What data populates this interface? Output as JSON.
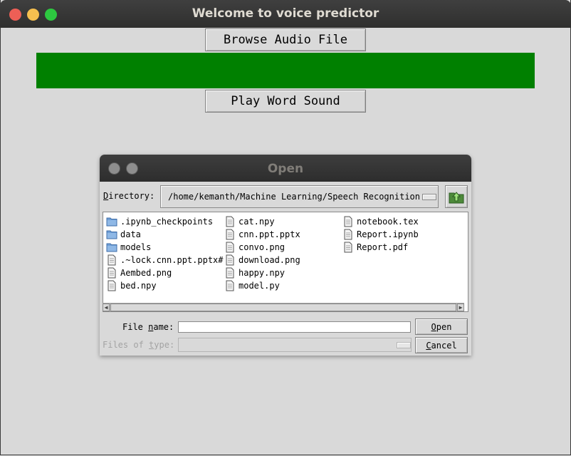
{
  "window": {
    "title": "Welcome to voice predictor",
    "controls": {
      "close_color": "#ed5f56",
      "minimize_color": "#f5bf4f",
      "maximize_color": "#2dc840"
    }
  },
  "main": {
    "browse_label": "Browse Audio File",
    "play_label": "Play Word Sound",
    "status_bar_color": "#008000"
  },
  "dialog": {
    "title": "Open",
    "directory": {
      "label_pre": "",
      "label_u": "D",
      "label_post": "irectory:",
      "value": "/home/kemanth/Machine Learning/Speech Recognition"
    },
    "files": [
      {
        "name": ".ipynb_checkpoints",
        "type": "folder"
      },
      {
        "name": "data",
        "type": "folder"
      },
      {
        "name": "models",
        "type": "folder"
      },
      {
        "name": ".~lock.cnn.ppt.pptx#",
        "type": "file"
      },
      {
        "name": "Aembed.png",
        "type": "file"
      },
      {
        "name": "bed.npy",
        "type": "file"
      },
      {
        "name": "cat.npy",
        "type": "file"
      },
      {
        "name": "cnn.ppt.pptx",
        "type": "file"
      },
      {
        "name": "convo.png",
        "type": "file"
      },
      {
        "name": "download.png",
        "type": "file"
      },
      {
        "name": "happy.npy",
        "type": "file"
      },
      {
        "name": "model.py",
        "type": "file"
      },
      {
        "name": "notebook.tex",
        "type": "file"
      },
      {
        "name": "Report.ipynb",
        "type": "file"
      },
      {
        "name": "Report.pdf",
        "type": "file"
      }
    ],
    "filename": {
      "label_pre": "File ",
      "label_u": "n",
      "label_post": "ame:",
      "value": ""
    },
    "filetype": {
      "label_pre": "Files of ",
      "label_u": "t",
      "label_post": "ype:"
    },
    "open_button": {
      "u": "O",
      "rest": "pen"
    },
    "cancel_button": {
      "u": "C",
      "rest": "ancel"
    }
  }
}
